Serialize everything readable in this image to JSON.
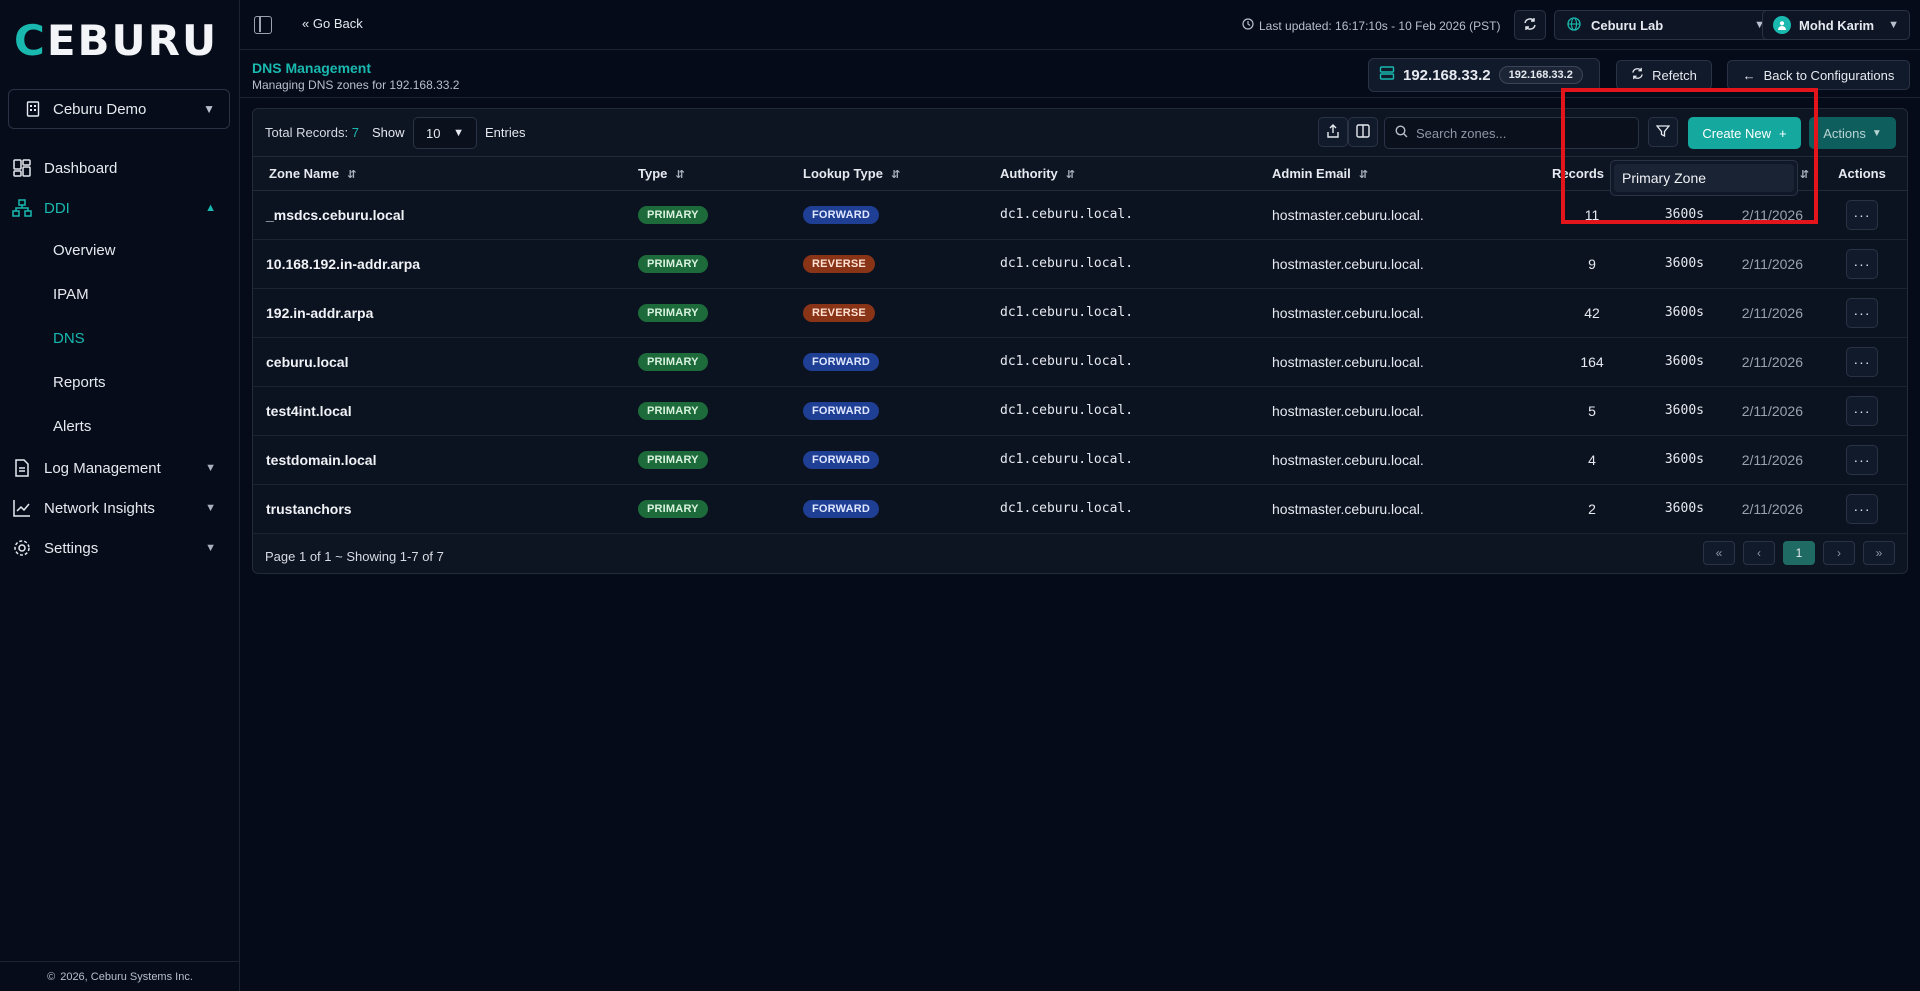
{
  "sidebar": {
    "logo_text": "CEBURU",
    "org": "Ceburu Demo",
    "nav": [
      {
        "label": "Dashboard",
        "icon": "dashboard-icon"
      },
      {
        "label": "DDI",
        "icon": "network-tree-icon"
      },
      {
        "label": "Log Management",
        "icon": "document-icon"
      },
      {
        "label": "Network Insights",
        "icon": "chart-icon"
      },
      {
        "label": "Settings",
        "icon": "gear-icon"
      }
    ],
    "ddi_sub": [
      "Overview",
      "IPAM",
      "DNS",
      "Reports",
      "Alerts"
    ],
    "footer": "2026, Ceburu Systems Inc."
  },
  "topbar": {
    "go_back": "Go Back",
    "last_updated": "Last updated: 16:17:10s - 10 Feb 2026 (PST)",
    "lab": "Ceburu Lab",
    "user": "Mohd Karim"
  },
  "header": {
    "title": "DNS Management",
    "subtitle": "Managing DNS zones for 192.168.33.2",
    "ip": "192.168.33.2",
    "ip_badge": "192.168.33.2",
    "refetch": "Refetch",
    "back_to_config": "Back to Configurations"
  },
  "toolbar": {
    "total_label": "Total Records:",
    "total_value": "7",
    "show_label": "Show",
    "page_size": "10",
    "entries_label": "Entries",
    "search_placeholder": "Search zones...",
    "create_new": "Create New",
    "actions": "Actions"
  },
  "dropdown": {
    "option": "Primary Zone"
  },
  "table": {
    "columns": [
      "Zone Name",
      "Type",
      "Lookup Type",
      "Authority",
      "Admin Email",
      "Records",
      "Actions"
    ],
    "rows": [
      {
        "zone": "_msdcs.ceburu.local",
        "type": "PRIMARY",
        "lookup": "FORWARD",
        "authority": "dc1.ceburu.local.",
        "email": "hostmaster.ceburu.local.",
        "records": "11",
        "ttl": "3600s",
        "date": "2/11/2026"
      },
      {
        "zone": "10.168.192.in-addr.arpa",
        "type": "PRIMARY",
        "lookup": "REVERSE",
        "authority": "dc1.ceburu.local.",
        "email": "hostmaster.ceburu.local.",
        "records": "9",
        "ttl": "3600s",
        "date": "2/11/2026"
      },
      {
        "zone": "192.in-addr.arpa",
        "type": "PRIMARY",
        "lookup": "REVERSE",
        "authority": "dc1.ceburu.local.",
        "email": "hostmaster.ceburu.local.",
        "records": "42",
        "ttl": "3600s",
        "date": "2/11/2026"
      },
      {
        "zone": "ceburu.local",
        "type": "PRIMARY",
        "lookup": "FORWARD",
        "authority": "dc1.ceburu.local.",
        "email": "hostmaster.ceburu.local.",
        "records": "164",
        "ttl": "3600s",
        "date": "2/11/2026"
      },
      {
        "zone": "test4int.local",
        "type": "PRIMARY",
        "lookup": "FORWARD",
        "authority": "dc1.ceburu.local.",
        "email": "hostmaster.ceburu.local.",
        "records": "5",
        "ttl": "3600s",
        "date": "2/11/2026"
      },
      {
        "zone": "testdomain.local",
        "type": "PRIMARY",
        "lookup": "FORWARD",
        "authority": "dc1.ceburu.local.",
        "email": "hostmaster.ceburu.local.",
        "records": "4",
        "ttl": "3600s",
        "date": "2/11/2026"
      },
      {
        "zone": "trustanchors",
        "type": "PRIMARY",
        "lookup": "FORWARD",
        "authority": "dc1.ceburu.local.",
        "email": "hostmaster.ceburu.local.",
        "records": "2",
        "ttl": "3600s",
        "date": "2/11/2026"
      }
    ]
  },
  "pagination": {
    "summary": "Page 1 of 1 ~ Showing 1-7 of 7",
    "current": "1"
  },
  "colors": {
    "accent": "#19b9b0",
    "background": "#050b18",
    "highlight": "#e3151b"
  }
}
